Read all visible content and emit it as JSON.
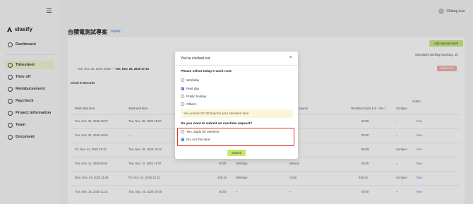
{
  "app": {
    "logo": "slasify"
  },
  "sidebar": {
    "items": [
      {
        "label": "Dashboard",
        "icon": "dashboard-icon"
      },
      {
        "label": "Timesheet",
        "icon": "clock-icon"
      },
      {
        "label": "Time off",
        "icon": "time-off-icon"
      },
      {
        "label": "Reimbursement",
        "icon": "reimbursement-icon"
      },
      {
        "label": "Paycheck",
        "icon": "paycheck-icon"
      },
      {
        "label": "Project Information",
        "icon": "project-icon"
      },
      {
        "label": "Team",
        "icon": "team-icon"
      },
      {
        "label": "Document",
        "icon": "document-icon"
      }
    ],
    "active_index": 1
  },
  "header": {
    "user_name": "Chiang Lua"
  },
  "page": {
    "title": "台積電測試專案",
    "badge": "Ongoing",
    "add_manual_hours": "Add manual hours",
    "scheduled_hours": "Scheduled working hour/Day: 10",
    "clock_range_start": "Tue, Nov. 25, 2025 16:50",
    "clock_range_sep": " — ",
    "clock_range_end": "Tue, Nov. 25, 2025 17:24",
    "clock_out_button": "Clock Out",
    "records_title": "Clock-in Records"
  },
  "table": {
    "action_header": "Action",
    "headers": [
      "Work start time",
      "Work end time",
      "d source",
      "Overtime hours ( hr : min )",
      "Compen"
    ],
    "rows": [
      {
        "start": "Tue, Nov. 25, 2025 15:07",
        "end": "Tue, Nov. 25, 2025 15:07",
        "c1": "",
        "c2": "",
        "source": "",
        "ot": "00:00",
        "comp": "--",
        "action": "View"
      },
      {
        "start": "Tue, Nov. 25, 2025 16:50",
        "end": "--",
        "c1": "",
        "c2": "",
        "source": "",
        "ot": "00:00",
        "comp": "--",
        "action": "View"
      },
      {
        "start": "Fri, Nov. 21, 2025 15:12",
        "end": "Tue, Nov. 25, 2025 15:12",
        "c1": "",
        "c2": "",
        "source": "",
        "ot": "86:39",
        "comp": "Compen",
        "action": "View"
      },
      {
        "start": "Tue, Nov. 11, 2025 08:04",
        "end": "Tue, Nov. 11, 2025 14:07",
        "c1": "00:00",
        "c2": "Workday",
        "source": "Manual",
        "ot": "00:00",
        "comp": "--",
        "action": "View"
      },
      {
        "start": "Mon, Nov. 03, 2025 11:55",
        "end": "Fri, Nov. 21, 2025 15:12",
        "c1": "435:16",
        "c2": "Workday",
        "source": "Clock",
        "ot": "435:16",
        "comp": "Compen",
        "action": "View"
      },
      {
        "start": "Tue, Sep. 16, 2025 11:22",
        "end": "Tue, Sep. 16, 2025 20:00",
        "c1": "00:00",
        "c2": "--",
        "source": "--",
        "ot": "00:00",
        "comp": "--",
        "action": "View"
      }
    ]
  },
  "modal": {
    "title": "You've clocked out",
    "close_glyph": "×",
    "work_note_question": "Please select today's work note",
    "work_note_options": [
      "Workday",
      "Rest day",
      "Public holiday",
      "Others"
    ],
    "work_note_selected": 1,
    "notice": "You worked 01:28 beyond your standard time",
    "overtime_question": "Do you want to submit an overtime request?",
    "overtime_options": [
      "Yes, apply for overtime",
      "No, not this time"
    ],
    "overtime_selected": 1,
    "submit": "Submit"
  },
  "colors": {
    "accent_green": "#c8e86b",
    "radio_blue": "#2f63c7",
    "highlight_red": "#e0312a",
    "clock_out_red": "#e6a4a4"
  }
}
